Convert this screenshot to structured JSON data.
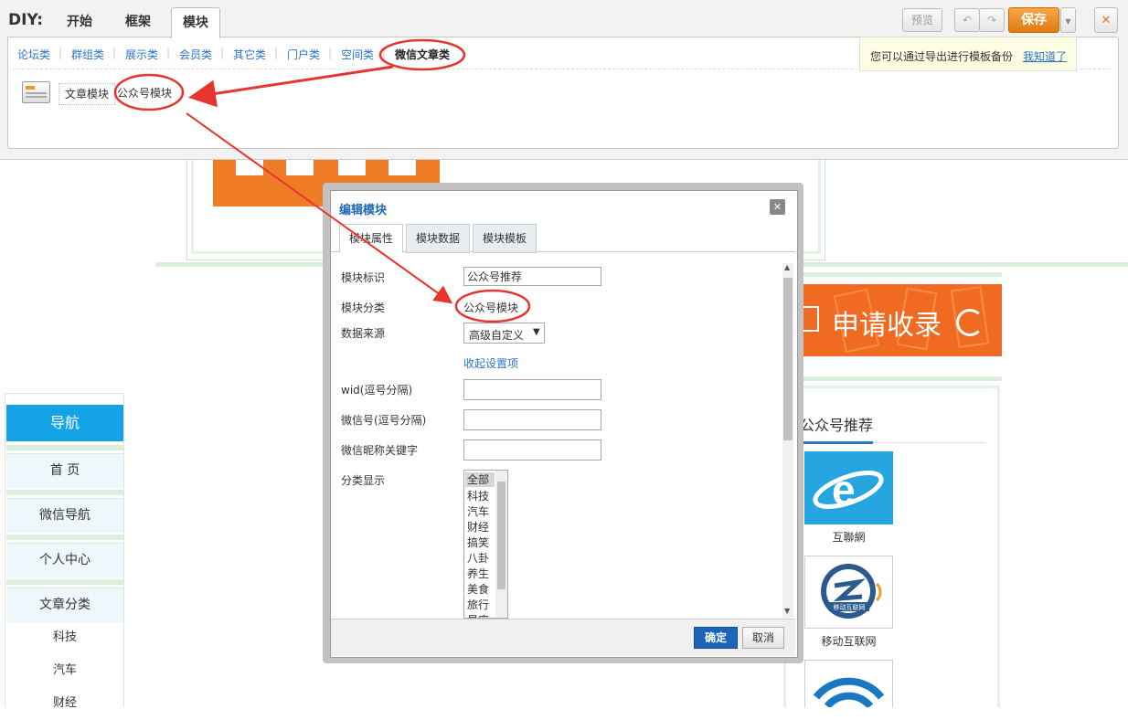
{
  "toolbar": {
    "diy_label": "DIY:",
    "tabs": [
      "开始",
      "框架",
      "模块"
    ],
    "preview_label": "预览",
    "save_label": "保存",
    "close_glyph": "✕"
  },
  "categories": [
    "论坛类",
    "群组类",
    "展示类",
    "会员类",
    "其它类",
    "门户类",
    "空间类",
    "微信文章类"
  ],
  "modules": [
    "文章模块",
    "公众号模块"
  ],
  "tip": {
    "text": "您可以通过导出进行模板备份",
    "link": "我知道了"
  },
  "page": {
    "banner_text": "申请收录",
    "nav": {
      "title": "导航",
      "items": [
        "首 页",
        "微信导航",
        "个人中心",
        "文章分类"
      ],
      "sub_items": [
        "科技",
        "汽车",
        "财经"
      ]
    },
    "recommend": {
      "title": "公众号推荐",
      "items": [
        "互聯網",
        "移动互联网"
      ],
      "badge_text": "移动互联网"
    }
  },
  "dialog": {
    "title": "编辑模块",
    "tabs": [
      "模块属性",
      "模块数据",
      "模块模板"
    ],
    "fields": {
      "id_label": "模块标识",
      "id_value": "公众号推荐",
      "category_label": "模块分类",
      "category_value": "公众号模块",
      "source_label": "数据来源",
      "source_value": "高级自定义",
      "collapse_link": "收起设置项",
      "wid_label": "wid(逗号分隔)",
      "wechat_label": "微信号(逗号分隔)",
      "nickname_label": "微信昵称关键字",
      "display_label": "分类显示"
    },
    "list_options": [
      "全部",
      "科技",
      "汽车",
      "财经",
      "搞笑",
      "八卦",
      "养生",
      "美食",
      "旅行",
      "星座"
    ],
    "ok_label": "确定",
    "cancel_label": "取消"
  },
  "colors": {
    "accent": "#2a74c9",
    "save": "#e88a1e",
    "nav_blue": "#13a3e6",
    "annotation_red": "#e8342e",
    "banner_orange": "#f06a22"
  }
}
